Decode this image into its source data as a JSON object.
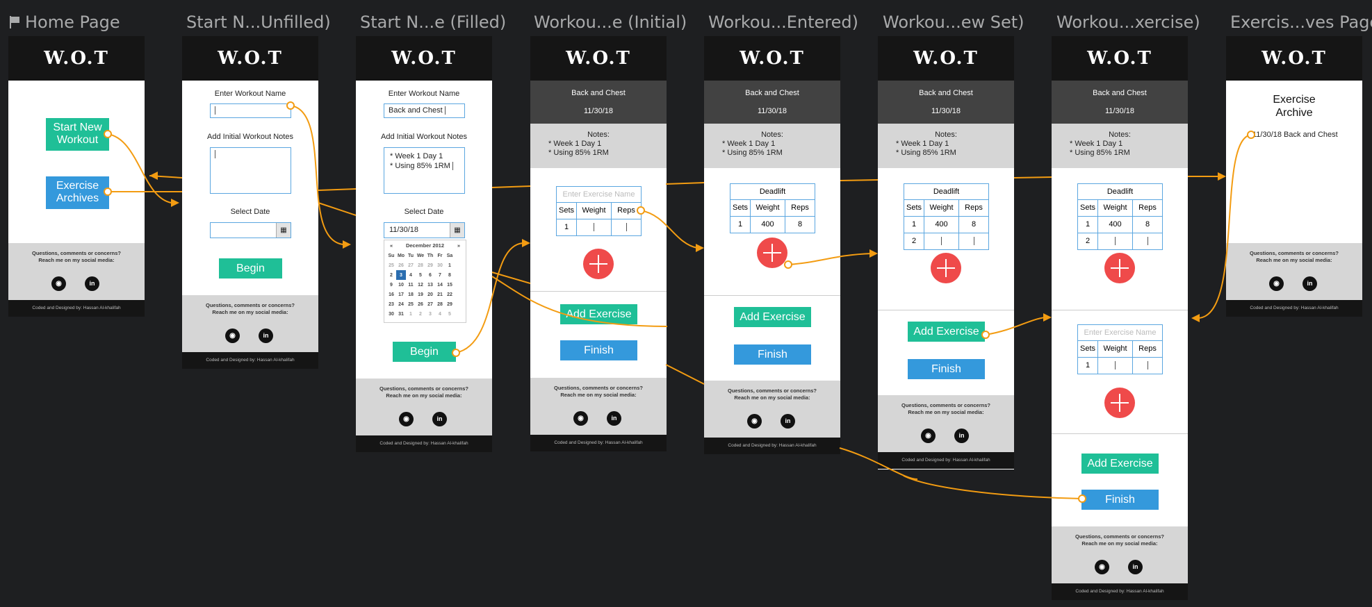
{
  "colors": {
    "canvas": "#1e1f21",
    "wire": "#f39c12",
    "green": "#1fbf97",
    "blue": "#3499dc",
    "red": "#ef4a4a",
    "header": "#151515"
  },
  "artboard_titles": [
    "Home Page",
    "Start N...Unfilled)",
    "Start N...e (Filled)",
    "Workou...e (Initial)",
    "Workou...Entered)",
    "Workou...ew Set)",
    "Workou...xercise)",
    "Exercis...ves Page"
  ],
  "common": {
    "logo": "W.O.T",
    "footer_q1": "Questions, comments or concerns?",
    "footer_q2": "Reach me on my social media:",
    "github_icon": "github-icon",
    "linkedin_icon": "linkedin-icon",
    "github_glyph": "◉",
    "linkedin_glyph": "in",
    "copyright": "Coded and Designed by: Hassan Al-khalifah"
  },
  "home": {
    "start_btn_l1": "Start New",
    "start_btn_l2": "Workout",
    "archive_btn_l1": "Exercise",
    "archive_btn_l2": "Archives"
  },
  "start_form": {
    "name_label": "Enter Workout Name",
    "notes_label": "Add Initial Workout Notes",
    "date_label": "Select Date",
    "begin": "Begin",
    "filled_name": "Back and Chest",
    "filled_note1": "* Week 1 Day 1",
    "filled_note2": "* Using 85% 1RM",
    "filled_date": "11/30/18",
    "calendar": {
      "prev": "«",
      "next": "»",
      "month": "December 2012",
      "weekdays": [
        "Su",
        "Mo",
        "Tu",
        "We",
        "Th",
        "Fr",
        "Sa"
      ],
      "weeks": [
        [
          "25",
          "26",
          "27",
          "28",
          "29",
          "30",
          "1"
        ],
        [
          "2",
          "3",
          "4",
          "5",
          "6",
          "7",
          "8"
        ],
        [
          "9",
          "10",
          "11",
          "12",
          "13",
          "14",
          "15"
        ],
        [
          "16",
          "17",
          "18",
          "19",
          "20",
          "21",
          "22"
        ],
        [
          "23",
          "24",
          "25",
          "26",
          "27",
          "28",
          "29"
        ],
        [
          "30",
          "31",
          "1",
          "2",
          "3",
          "4",
          "5"
        ]
      ],
      "selected": "3"
    }
  },
  "workout": {
    "title": "Back and Chest",
    "date": "11/30/18",
    "notes_label": "Notes:",
    "note1": "* Week 1 Day 1",
    "note2": "* Using 85% 1RM",
    "exercise_placeholder": "Enter Exercise Name",
    "exercise_name": "Deadlift",
    "col_sets": "Sets",
    "col_weight": "Weight",
    "col_reps": "Reps",
    "set1": "1",
    "set2": "2",
    "weight1": "400",
    "reps1": "8",
    "add_exercise": "Add Exercise",
    "finish": "Finish"
  },
  "archive": {
    "title_l1": "Exercise",
    "title_l2": "Archive",
    "entry": "11/30/18 Back and Chest"
  }
}
